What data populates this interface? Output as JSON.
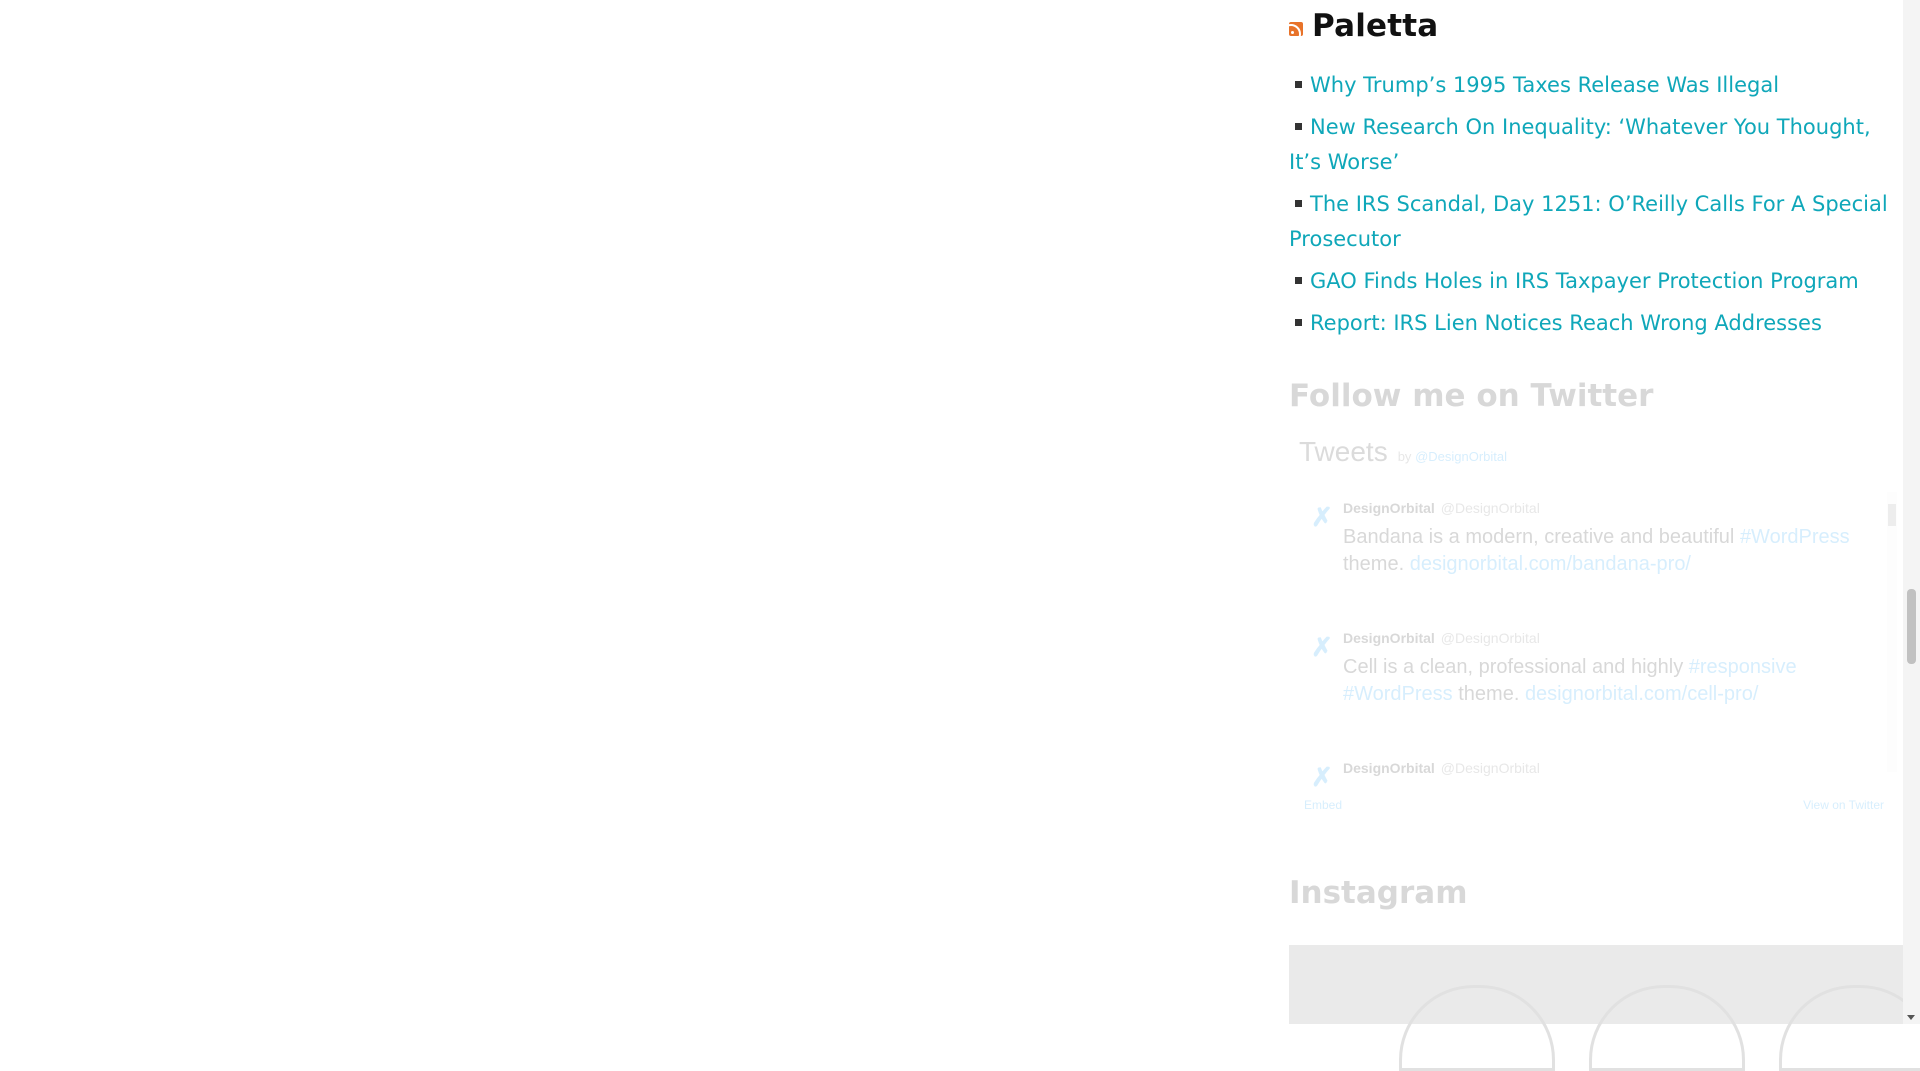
{
  "rss_widget": {
    "title": "Paletta",
    "items": [
      "Why Trump’s 1995 Taxes Release Was Illegal",
      "New Research On Inequality: ‘Whatever You Thought, It’s Worse’",
      "The IRS Scandal, Day 1251: O’Reilly Calls For A Special Prosecutor",
      "GAO Finds Holes in IRS Taxpayer Protection Program",
      "Report: IRS Lien Notices Reach Wrong Addresses"
    ]
  },
  "twitter_widget": {
    "heading": "Follow me on Twitter",
    "timeline_title": "Tweets",
    "by_prefix": "by",
    "by_handle": "@DesignOrbital",
    "tweets": [
      {
        "name": "DesignOrbital",
        "handle": "@DesignOrbital",
        "text_before": "Bandana is a modern, creative and beautiful ",
        "hashtag1": "#WordPress",
        "text_middle": " theme. ",
        "link": "designorbital.com/bandana-pro/"
      },
      {
        "name": "DesignOrbital",
        "handle": "@DesignOrbital",
        "text_before": "Cell is a clean, professional and highly ",
        "hashtag1": "#responsive",
        "hashtag2": "#WordPress",
        "text_middle": " theme. ",
        "link": "designorbital.com/cell-pro/"
      },
      {
        "name": "DesignOrbital",
        "handle": "@DesignOrbital"
      }
    ],
    "footer_embed": "Embed",
    "footer_view": "View on Twitter"
  },
  "instagram_widget": {
    "heading": "Instagram"
  },
  "colors": {
    "link": "#0fa7b9",
    "rss_icon": "#e8732a",
    "twitter_blue": "#1da1f2"
  }
}
